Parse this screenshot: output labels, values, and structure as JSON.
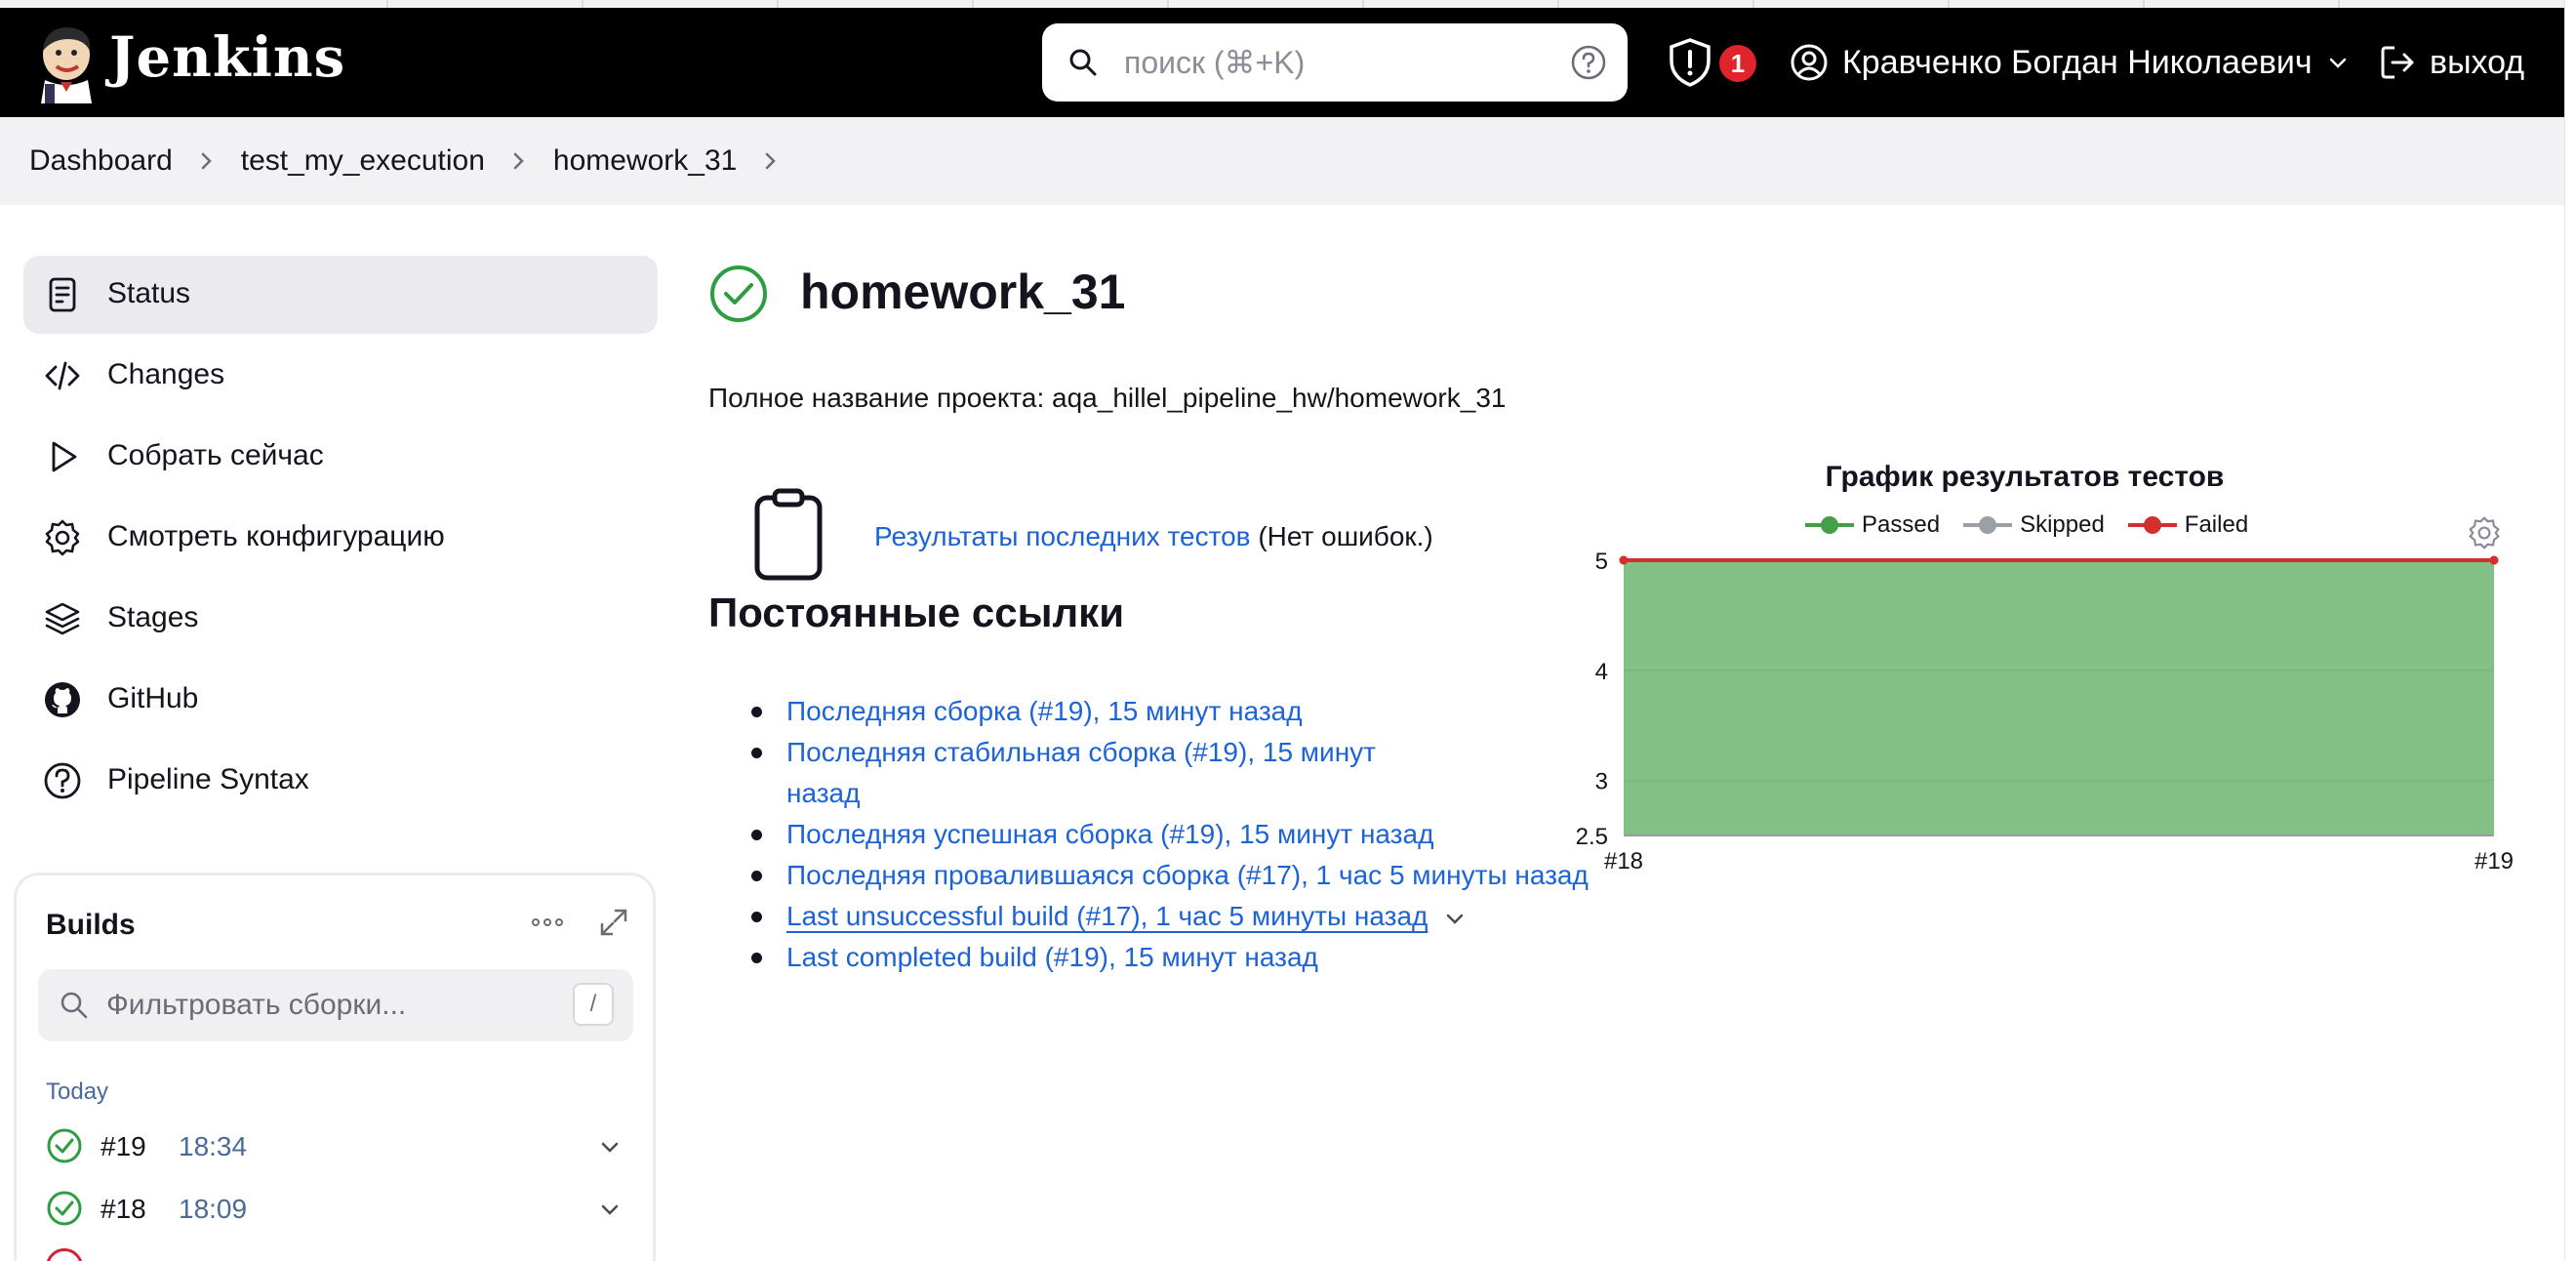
{
  "header": {
    "brand": "Jenkins",
    "search_placeholder": "поиск (⌘+K)",
    "security_count": "1",
    "user_name": "Кравченко Богдан Николаевич",
    "logout_label": "выход"
  },
  "breadcrumbs": [
    "Dashboard",
    "test_my_execution",
    "homework_31"
  ],
  "sidebar": {
    "items": [
      {
        "label": "Status",
        "icon": "clipboard-icon"
      },
      {
        "label": "Changes",
        "icon": "code-icon"
      },
      {
        "label": "Собрать сейчас",
        "icon": "play-icon"
      },
      {
        "label": "Смотреть конфигурацию",
        "icon": "gear-icon"
      },
      {
        "label": "Stages",
        "icon": "layers-icon"
      },
      {
        "label": "GitHub",
        "icon": "github-icon"
      },
      {
        "label": "Pipeline Syntax",
        "icon": "help-icon"
      }
    ]
  },
  "builds": {
    "title": "Builds",
    "filter_placeholder": "Фильтровать сборки...",
    "shortcut": "/",
    "group_label": "Today",
    "rows": [
      {
        "number": "#19",
        "time": "18:34",
        "status": "success"
      },
      {
        "number": "#18",
        "time": "18:09",
        "status": "success"
      }
    ]
  },
  "main": {
    "title": "homework_31",
    "full_name": "Полное название проекта: aqa_hillel_pipeline_hw/homework_31",
    "last_tests_link": "Результаты последних тестов",
    "last_tests_note": " (Нет ошибок.)",
    "permalinks_heading": "Постоянные ссылки",
    "permalinks": [
      "Последняя сборка (#19), 15 минут назад",
      "Последняя стабильная сборка (#19), 15 минут назад",
      "Последняя успешная сборка (#19), 15 минут назад",
      "Последняя провалившаяся сборка (#17), 1 час 5 минуты назад",
      "Last unsuccessful build (#17), 1 час 5 минуты назад",
      "Last completed build (#19), 15 минут назад"
    ]
  },
  "chart_data": {
    "type": "area",
    "title": "График результатов тестов",
    "categories": [
      "#18",
      "#19"
    ],
    "series": [
      {
        "name": "Passed",
        "values": [
          5,
          5
        ],
        "color": "#43a047"
      },
      {
        "name": "Skipped",
        "values": [
          0,
          0
        ],
        "color": "#9aa0a6"
      },
      {
        "name": "Failed",
        "values": [
          0,
          0
        ],
        "color": "#d32f2f"
      }
    ],
    "yticks": [
      "5",
      "4",
      "3",
      "2.5"
    ],
    "ylim": [
      2.5,
      5
    ],
    "legend_position": "top",
    "grid": true
  }
}
